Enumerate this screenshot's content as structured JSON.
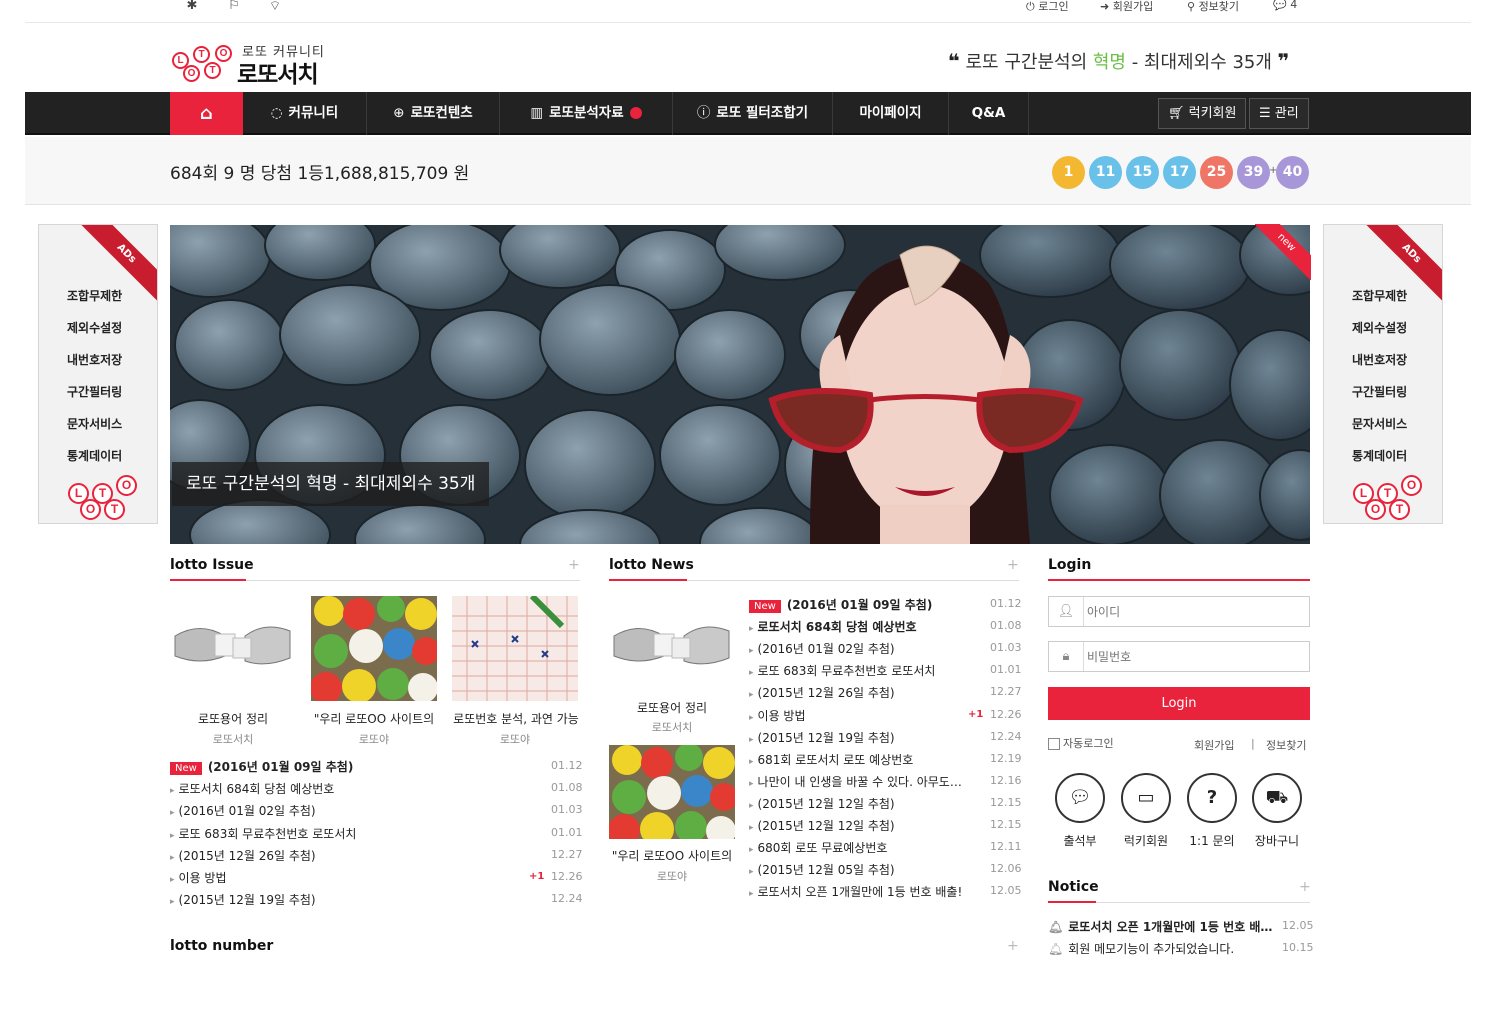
{
  "topbar": {
    "left_icons": [
      "bug-icon",
      "bookmark-icon",
      "rss-icon"
    ],
    "login": "로그인",
    "join": "회원가입",
    "find_info": "정보찾기",
    "comments_count": "4"
  },
  "header": {
    "logo_letters": [
      "L",
      "O",
      "T",
      "T",
      "O"
    ],
    "logo_sub": "로또 커뮤니티",
    "logo_main": "로또서치",
    "slogan_prefix": "로또 구간분석의 ",
    "slogan_highlight": "혁명",
    "slogan_suffix": " - 최대제외수 35개"
  },
  "nav": {
    "items": [
      "커뮤니티",
      "로또컨텐츠",
      "로또분석자료",
      "로또 필터조합기",
      "마이페이지",
      "Q&A"
    ],
    "lucky_member": "럭키회원",
    "admin": "관리"
  },
  "winbar": {
    "text": "684회 9 명 당첨  1등1,688,815,709 원",
    "balls": [
      "1",
      "11",
      "15",
      "17",
      "25",
      "39",
      "40"
    ],
    "plus": "+",
    "ball_colors": [
      "#f4b731",
      "#69c0e8",
      "#69c0e8",
      "#69c0e8",
      "#ef7567",
      "#a796d8",
      "#a796d8"
    ]
  },
  "ads": {
    "ribbon": "ADs",
    "items": [
      "조합무제한",
      "제외수설정",
      "내번호저장",
      "구간필터링",
      "문자서비스",
      "통계데이터"
    ]
  },
  "hero": {
    "caption": "로또 구간분석의 혁명 - 최대제외수 35개",
    "corner": "new"
  },
  "issue": {
    "title": "lotto Issue",
    "plus": "+",
    "thumbs": [
      {
        "caption": "로또용어 정리",
        "author": "로또서치"
      },
      {
        "caption": "\"우리 로또OO 사이트의",
        "author": "로또야"
      },
      {
        "caption": "로또번호 분석, 과연 가능",
        "author": "로또야"
      }
    ],
    "list": [
      {
        "badge": "New",
        "text": "(2016년 01월 09일 추첨)",
        "date": "01.12",
        "bold": true
      },
      {
        "text": "로또서치 684회 당첨 예상번호",
        "date": "01.08"
      },
      {
        "text": "(2016년 01월 02일 추첨)",
        "date": "01.03"
      },
      {
        "text": "로또 683회 무료추천번호 로또서치",
        "date": "01.01"
      },
      {
        "text": "(2015년 12월 26일 추첨)",
        "date": "12.27"
      },
      {
        "text": "이용 방법",
        "date": "12.26",
        "count": "+1"
      },
      {
        "text": "(2015년 12월 19일 추첨)",
        "date": "12.24"
      }
    ]
  },
  "news": {
    "title": "lotto News",
    "plus": "+",
    "thumbs": [
      {
        "caption": "로또용어 정리",
        "author": "로또서치"
      },
      {
        "caption": "\"우리 로또OO 사이트의",
        "author": "로또야"
      }
    ],
    "list": [
      {
        "badge": "New",
        "text": "(2016년 01월 09일 추첨)",
        "date": "01.12",
        "bold": true
      },
      {
        "text": "로또서치 684회 당첨 예상번호",
        "date": "01.08",
        "bold": true
      },
      {
        "text": "(2016년 01월 02일 추첨)",
        "date": "01.03"
      },
      {
        "text": "로또 683회 무료추천번호 로또서치",
        "date": "01.01"
      },
      {
        "text": "(2015년 12월 26일 추첨)",
        "date": "12.27"
      },
      {
        "text": "이용 방법",
        "date": "12.26",
        "count": "+1"
      },
      {
        "text": "(2015년 12월 19일 추첨)",
        "date": "12.24"
      },
      {
        "text": "681회 로또서치 로또 예상번호",
        "date": "12.19"
      },
      {
        "text": "나만이 내 인생을 바꿀 수 있다. 아무도…",
        "date": "12.16"
      },
      {
        "text": "(2015년 12월 12일 추첨)",
        "date": "12.15"
      },
      {
        "text": "(2015년 12월 12일 추첨)",
        "date": "12.15"
      },
      {
        "text": "680회 로또 무료예상번호",
        "date": "12.11"
      },
      {
        "text": "(2015년 12월 05일 추첨)",
        "date": "12.06"
      },
      {
        "text": "로또서치 오픈 1개월만에 1등 번호 배출!",
        "date": "12.05"
      }
    ]
  },
  "lotto_number": {
    "title": "lotto number",
    "plus": "+"
  },
  "login": {
    "title": "Login",
    "id_placeholder": "아이디",
    "pw_placeholder": "비밀번호",
    "button": "Login",
    "auto_login": "자동로그인",
    "join": "회원가입",
    "separator": "|",
    "find": "정보찾기",
    "quick": [
      {
        "icon": "chat-icon",
        "label": "출석부"
      },
      {
        "icon": "battery-icon",
        "label": "럭키회원"
      },
      {
        "icon": "question-icon",
        "label": "1:1 문의"
      },
      {
        "icon": "truck-icon",
        "label": "장바구니"
      }
    ]
  },
  "notice": {
    "title": "Notice",
    "plus": "+",
    "list": [
      {
        "text": "로또서치 오픈 1개월만에 1등 번호 배…",
        "date": "12.05",
        "bold": true
      },
      {
        "text": "회원 메모기능이 추가되었습니다.",
        "date": "10.15"
      }
    ]
  }
}
